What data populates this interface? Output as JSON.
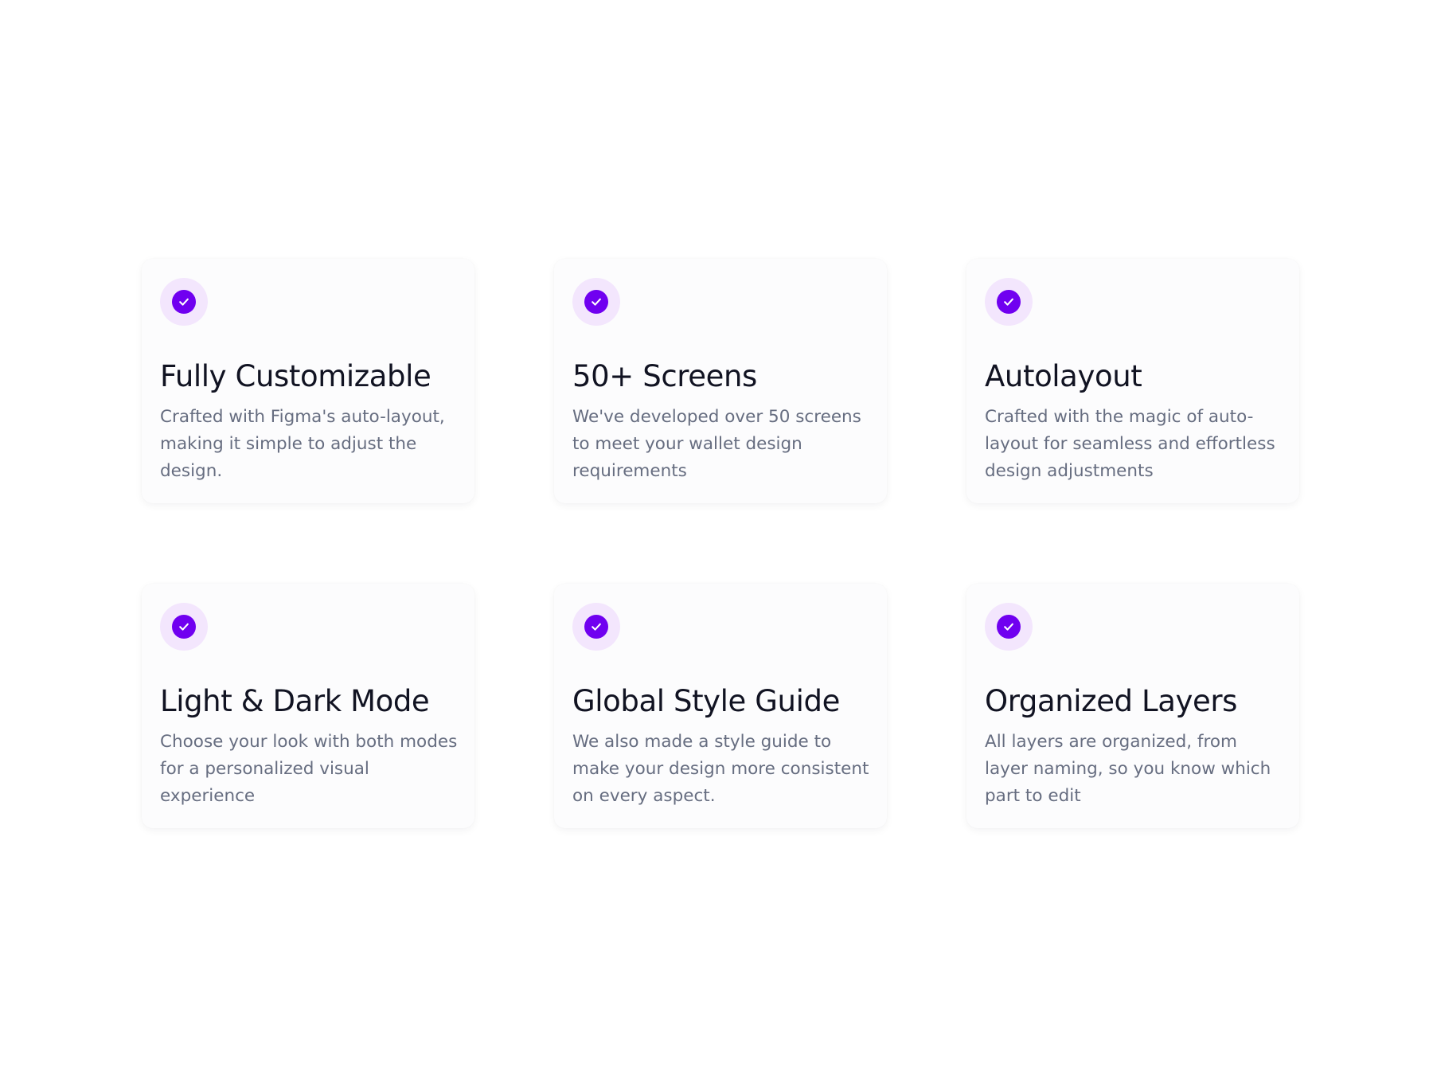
{
  "colors": {
    "accent": "#7000f0",
    "accent_soft": "#f3e6fd",
    "title": "#111322",
    "body_text": "#666d80",
    "card_background": "#fcfcfd",
    "page_background": "#ffffff"
  },
  "icon": "check-circle-icon",
  "features": [
    {
      "title": "Fully Customizable",
      "description": "Crafted with Figma's auto-layout, making it simple to adjust the design."
    },
    {
      "title": "50+ Screens",
      "description": "We've developed over 50 screens to meet your wallet design requirements"
    },
    {
      "title": "Autolayout",
      "description": "Crafted with the magic of auto-layout for seamless and effortless design adjustments"
    },
    {
      "title": "Light & Dark Mode",
      "description": "Choose your look with both modes for a personalized visual experience"
    },
    {
      "title": "Global Style Guide",
      "description": "We also made a style guide to make your design more consistent on every aspect."
    },
    {
      "title": "Organized Layers",
      "description": "All layers are organized, from layer naming, so you know which part to edit"
    }
  ]
}
